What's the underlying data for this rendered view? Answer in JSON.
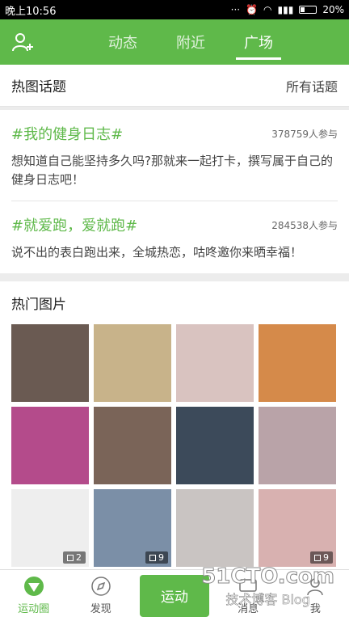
{
  "statusbar": {
    "time": "晚上10:56",
    "battery": "20%"
  },
  "tabs": [
    {
      "label": "动态"
    },
    {
      "label": "附近"
    },
    {
      "label": "广场"
    }
  ],
  "hot_topics": {
    "title": "热图话题",
    "more": "所有话题",
    "items": [
      {
        "title": "#我的健身日志#",
        "count": "378759人参与",
        "desc": "想知道自己能坚持多久吗?那就来一起打卡，撰写属于自己的健身日志吧！"
      },
      {
        "title": "#就爱跑，爱就跑#",
        "count": "284538人参与",
        "desc": "说不出的表白跑出来，全城热恋，咕咚邀你来晒幸福！"
      }
    ]
  },
  "hot_pics": {
    "title": "热门图片",
    "items": [
      {
        "color": "#6a5a52"
      },
      {
        "color": "#c8b38a"
      },
      {
        "color": "#d9c3c0"
      },
      {
        "color": "#d58a4a"
      },
      {
        "color": "#b44b8b"
      },
      {
        "color": "#7a6458"
      },
      {
        "color": "#3c4a5a"
      },
      {
        "color": "#b9a3a8"
      },
      {
        "color": "#eeeeee",
        "badge": "2"
      },
      {
        "color": "#7b8fa7",
        "badge": "9"
      },
      {
        "color": "#c9c4c2"
      },
      {
        "color": "#d8b1b0",
        "badge": "9"
      }
    ]
  },
  "bottom_nav": {
    "circle": "运动圈",
    "discover": "发现",
    "run": "运动",
    "messages": "消息",
    "me": "我"
  },
  "watermark": {
    "big": "51CTO.com",
    "small": "技术博客",
    "blog": "Blog"
  }
}
